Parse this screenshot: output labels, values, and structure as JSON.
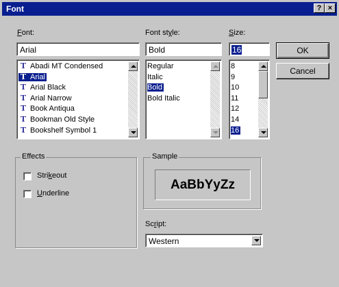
{
  "window": {
    "title": "Font",
    "help_label": "?",
    "close_label": "×"
  },
  "font": {
    "label_prefix": "",
    "label_underlined": "F",
    "label_rest": "ont:",
    "value": "Arial",
    "items": [
      {
        "label": "Abadi MT Condensed",
        "selected": false
      },
      {
        "label": "Arial",
        "selected": true
      },
      {
        "label": "Arial Black",
        "selected": false
      },
      {
        "label": "Arial Narrow",
        "selected": false
      },
      {
        "label": "Book Antiqua",
        "selected": false
      },
      {
        "label": "Bookman Old Style",
        "selected": false
      },
      {
        "label": "Bookshelf Symbol 1",
        "selected": false
      }
    ],
    "item_icon": "truetype-icon",
    "item_icon_glyph": "T"
  },
  "font_style": {
    "label_prefix": "Font st",
    "label_underlined": "y",
    "label_rest": "le:",
    "value": "Bold",
    "items": [
      {
        "label": "Regular",
        "selected": false
      },
      {
        "label": "Italic",
        "selected": false
      },
      {
        "label": "Bold",
        "selected": true
      },
      {
        "label": "Bold Italic",
        "selected": false
      }
    ]
  },
  "size": {
    "label_prefix": "",
    "label_underlined": "S",
    "label_rest": "ize:",
    "value": "16",
    "items": [
      {
        "label": "8",
        "selected": false
      },
      {
        "label": "9",
        "selected": false
      },
      {
        "label": "10",
        "selected": false
      },
      {
        "label": "11",
        "selected": false
      },
      {
        "label": "12",
        "selected": false
      },
      {
        "label": "14",
        "selected": false
      },
      {
        "label": "16",
        "selected": true
      }
    ]
  },
  "buttons": {
    "ok": "OK",
    "cancel": "Cancel"
  },
  "effects": {
    "title": "Effects",
    "strikeout": {
      "prefix": "Stri",
      "underlined": "k",
      "rest": "eout",
      "checked": false
    },
    "underline": {
      "prefix": "",
      "underlined": "U",
      "rest": "nderline",
      "checked": false
    }
  },
  "sample": {
    "title": "Sample",
    "text": "AaBbYyZz"
  },
  "script": {
    "label_prefix": "Sc",
    "label_underlined": "r",
    "label_rest": "ipt:",
    "value": "Western"
  },
  "colors": {
    "titlebar": "#0a1f8f",
    "selection": "#0a1f8f",
    "face": "#c6c6c6"
  }
}
